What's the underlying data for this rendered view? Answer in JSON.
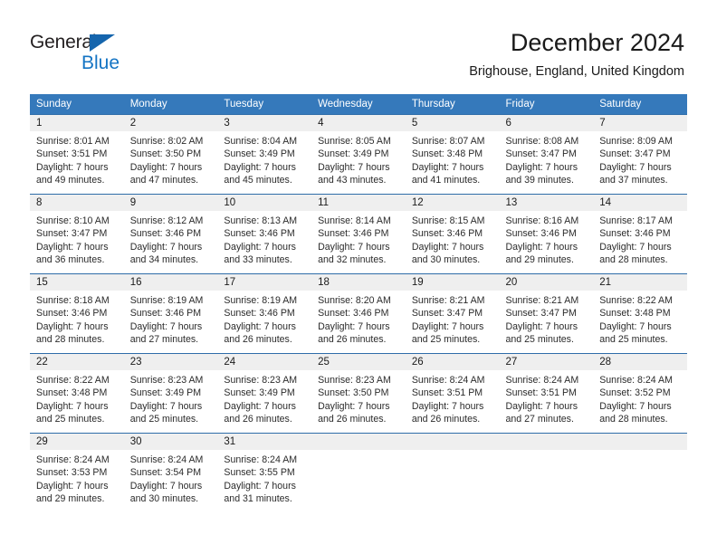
{
  "brand": {
    "name_part1": "General",
    "name_part2": "Blue",
    "accent_color": "#1474c4",
    "triangle_color": "#1565ad"
  },
  "header": {
    "title": "December 2024",
    "subtitle": "Brighouse, England, United Kingdom"
  },
  "calendar": {
    "header_bg": "#3579bb",
    "header_text_color": "#ffffff",
    "daynum_band_bg": "#efefef",
    "row_divider_color": "#2f6da9",
    "weekday_headers": [
      "Sunday",
      "Monday",
      "Tuesday",
      "Wednesday",
      "Thursday",
      "Friday",
      "Saturday"
    ],
    "weeks": [
      [
        {
          "day": "1",
          "sunrise": "Sunrise: 8:01 AM",
          "sunset": "Sunset: 3:51 PM",
          "daylight_line1": "Daylight: 7 hours",
          "daylight_line2": "and 49 minutes."
        },
        {
          "day": "2",
          "sunrise": "Sunrise: 8:02 AM",
          "sunset": "Sunset: 3:50 PM",
          "daylight_line1": "Daylight: 7 hours",
          "daylight_line2": "and 47 minutes."
        },
        {
          "day": "3",
          "sunrise": "Sunrise: 8:04 AM",
          "sunset": "Sunset: 3:49 PM",
          "daylight_line1": "Daylight: 7 hours",
          "daylight_line2": "and 45 minutes."
        },
        {
          "day": "4",
          "sunrise": "Sunrise: 8:05 AM",
          "sunset": "Sunset: 3:49 PM",
          "daylight_line1": "Daylight: 7 hours",
          "daylight_line2": "and 43 minutes."
        },
        {
          "day": "5",
          "sunrise": "Sunrise: 8:07 AM",
          "sunset": "Sunset: 3:48 PM",
          "daylight_line1": "Daylight: 7 hours",
          "daylight_line2": "and 41 minutes."
        },
        {
          "day": "6",
          "sunrise": "Sunrise: 8:08 AM",
          "sunset": "Sunset: 3:47 PM",
          "daylight_line1": "Daylight: 7 hours",
          "daylight_line2": "and 39 minutes."
        },
        {
          "day": "7",
          "sunrise": "Sunrise: 8:09 AM",
          "sunset": "Sunset: 3:47 PM",
          "daylight_line1": "Daylight: 7 hours",
          "daylight_line2": "and 37 minutes."
        }
      ],
      [
        {
          "day": "8",
          "sunrise": "Sunrise: 8:10 AM",
          "sunset": "Sunset: 3:47 PM",
          "daylight_line1": "Daylight: 7 hours",
          "daylight_line2": "and 36 minutes."
        },
        {
          "day": "9",
          "sunrise": "Sunrise: 8:12 AM",
          "sunset": "Sunset: 3:46 PM",
          "daylight_line1": "Daylight: 7 hours",
          "daylight_line2": "and 34 minutes."
        },
        {
          "day": "10",
          "sunrise": "Sunrise: 8:13 AM",
          "sunset": "Sunset: 3:46 PM",
          "daylight_line1": "Daylight: 7 hours",
          "daylight_line2": "and 33 minutes."
        },
        {
          "day": "11",
          "sunrise": "Sunrise: 8:14 AM",
          "sunset": "Sunset: 3:46 PM",
          "daylight_line1": "Daylight: 7 hours",
          "daylight_line2": "and 32 minutes."
        },
        {
          "day": "12",
          "sunrise": "Sunrise: 8:15 AM",
          "sunset": "Sunset: 3:46 PM",
          "daylight_line1": "Daylight: 7 hours",
          "daylight_line2": "and 30 minutes."
        },
        {
          "day": "13",
          "sunrise": "Sunrise: 8:16 AM",
          "sunset": "Sunset: 3:46 PM",
          "daylight_line1": "Daylight: 7 hours",
          "daylight_line2": "and 29 minutes."
        },
        {
          "day": "14",
          "sunrise": "Sunrise: 8:17 AM",
          "sunset": "Sunset: 3:46 PM",
          "daylight_line1": "Daylight: 7 hours",
          "daylight_line2": "and 28 minutes."
        }
      ],
      [
        {
          "day": "15",
          "sunrise": "Sunrise: 8:18 AM",
          "sunset": "Sunset: 3:46 PM",
          "daylight_line1": "Daylight: 7 hours",
          "daylight_line2": "and 28 minutes."
        },
        {
          "day": "16",
          "sunrise": "Sunrise: 8:19 AM",
          "sunset": "Sunset: 3:46 PM",
          "daylight_line1": "Daylight: 7 hours",
          "daylight_line2": "and 27 minutes."
        },
        {
          "day": "17",
          "sunrise": "Sunrise: 8:19 AM",
          "sunset": "Sunset: 3:46 PM",
          "daylight_line1": "Daylight: 7 hours",
          "daylight_line2": "and 26 minutes."
        },
        {
          "day": "18",
          "sunrise": "Sunrise: 8:20 AM",
          "sunset": "Sunset: 3:46 PM",
          "daylight_line1": "Daylight: 7 hours",
          "daylight_line2": "and 26 minutes."
        },
        {
          "day": "19",
          "sunrise": "Sunrise: 8:21 AM",
          "sunset": "Sunset: 3:47 PM",
          "daylight_line1": "Daylight: 7 hours",
          "daylight_line2": "and 25 minutes."
        },
        {
          "day": "20",
          "sunrise": "Sunrise: 8:21 AM",
          "sunset": "Sunset: 3:47 PM",
          "daylight_line1": "Daylight: 7 hours",
          "daylight_line2": "and 25 minutes."
        },
        {
          "day": "21",
          "sunrise": "Sunrise: 8:22 AM",
          "sunset": "Sunset: 3:48 PM",
          "daylight_line1": "Daylight: 7 hours",
          "daylight_line2": "and 25 minutes."
        }
      ],
      [
        {
          "day": "22",
          "sunrise": "Sunrise: 8:22 AM",
          "sunset": "Sunset: 3:48 PM",
          "daylight_line1": "Daylight: 7 hours",
          "daylight_line2": "and 25 minutes."
        },
        {
          "day": "23",
          "sunrise": "Sunrise: 8:23 AM",
          "sunset": "Sunset: 3:49 PM",
          "daylight_line1": "Daylight: 7 hours",
          "daylight_line2": "and 25 minutes."
        },
        {
          "day": "24",
          "sunrise": "Sunrise: 8:23 AM",
          "sunset": "Sunset: 3:49 PM",
          "daylight_line1": "Daylight: 7 hours",
          "daylight_line2": "and 26 minutes."
        },
        {
          "day": "25",
          "sunrise": "Sunrise: 8:23 AM",
          "sunset": "Sunset: 3:50 PM",
          "daylight_line1": "Daylight: 7 hours",
          "daylight_line2": "and 26 minutes."
        },
        {
          "day": "26",
          "sunrise": "Sunrise: 8:24 AM",
          "sunset": "Sunset: 3:51 PM",
          "daylight_line1": "Daylight: 7 hours",
          "daylight_line2": "and 26 minutes."
        },
        {
          "day": "27",
          "sunrise": "Sunrise: 8:24 AM",
          "sunset": "Sunset: 3:51 PM",
          "daylight_line1": "Daylight: 7 hours",
          "daylight_line2": "and 27 minutes."
        },
        {
          "day": "28",
          "sunrise": "Sunrise: 8:24 AM",
          "sunset": "Sunset: 3:52 PM",
          "daylight_line1": "Daylight: 7 hours",
          "daylight_line2": "and 28 minutes."
        }
      ],
      [
        {
          "day": "29",
          "sunrise": "Sunrise: 8:24 AM",
          "sunset": "Sunset: 3:53 PM",
          "daylight_line1": "Daylight: 7 hours",
          "daylight_line2": "and 29 minutes."
        },
        {
          "day": "30",
          "sunrise": "Sunrise: 8:24 AM",
          "sunset": "Sunset: 3:54 PM",
          "daylight_line1": "Daylight: 7 hours",
          "daylight_line2": "and 30 minutes."
        },
        {
          "day": "31",
          "sunrise": "Sunrise: 8:24 AM",
          "sunset": "Sunset: 3:55 PM",
          "daylight_line1": "Daylight: 7 hours",
          "daylight_line2": "and 31 minutes."
        },
        {
          "day": "",
          "sunrise": "",
          "sunset": "",
          "daylight_line1": "",
          "daylight_line2": ""
        },
        {
          "day": "",
          "sunrise": "",
          "sunset": "",
          "daylight_line1": "",
          "daylight_line2": ""
        },
        {
          "day": "",
          "sunrise": "",
          "sunset": "",
          "daylight_line1": "",
          "daylight_line2": ""
        },
        {
          "day": "",
          "sunrise": "",
          "sunset": "",
          "daylight_line1": "",
          "daylight_line2": ""
        }
      ]
    ]
  }
}
